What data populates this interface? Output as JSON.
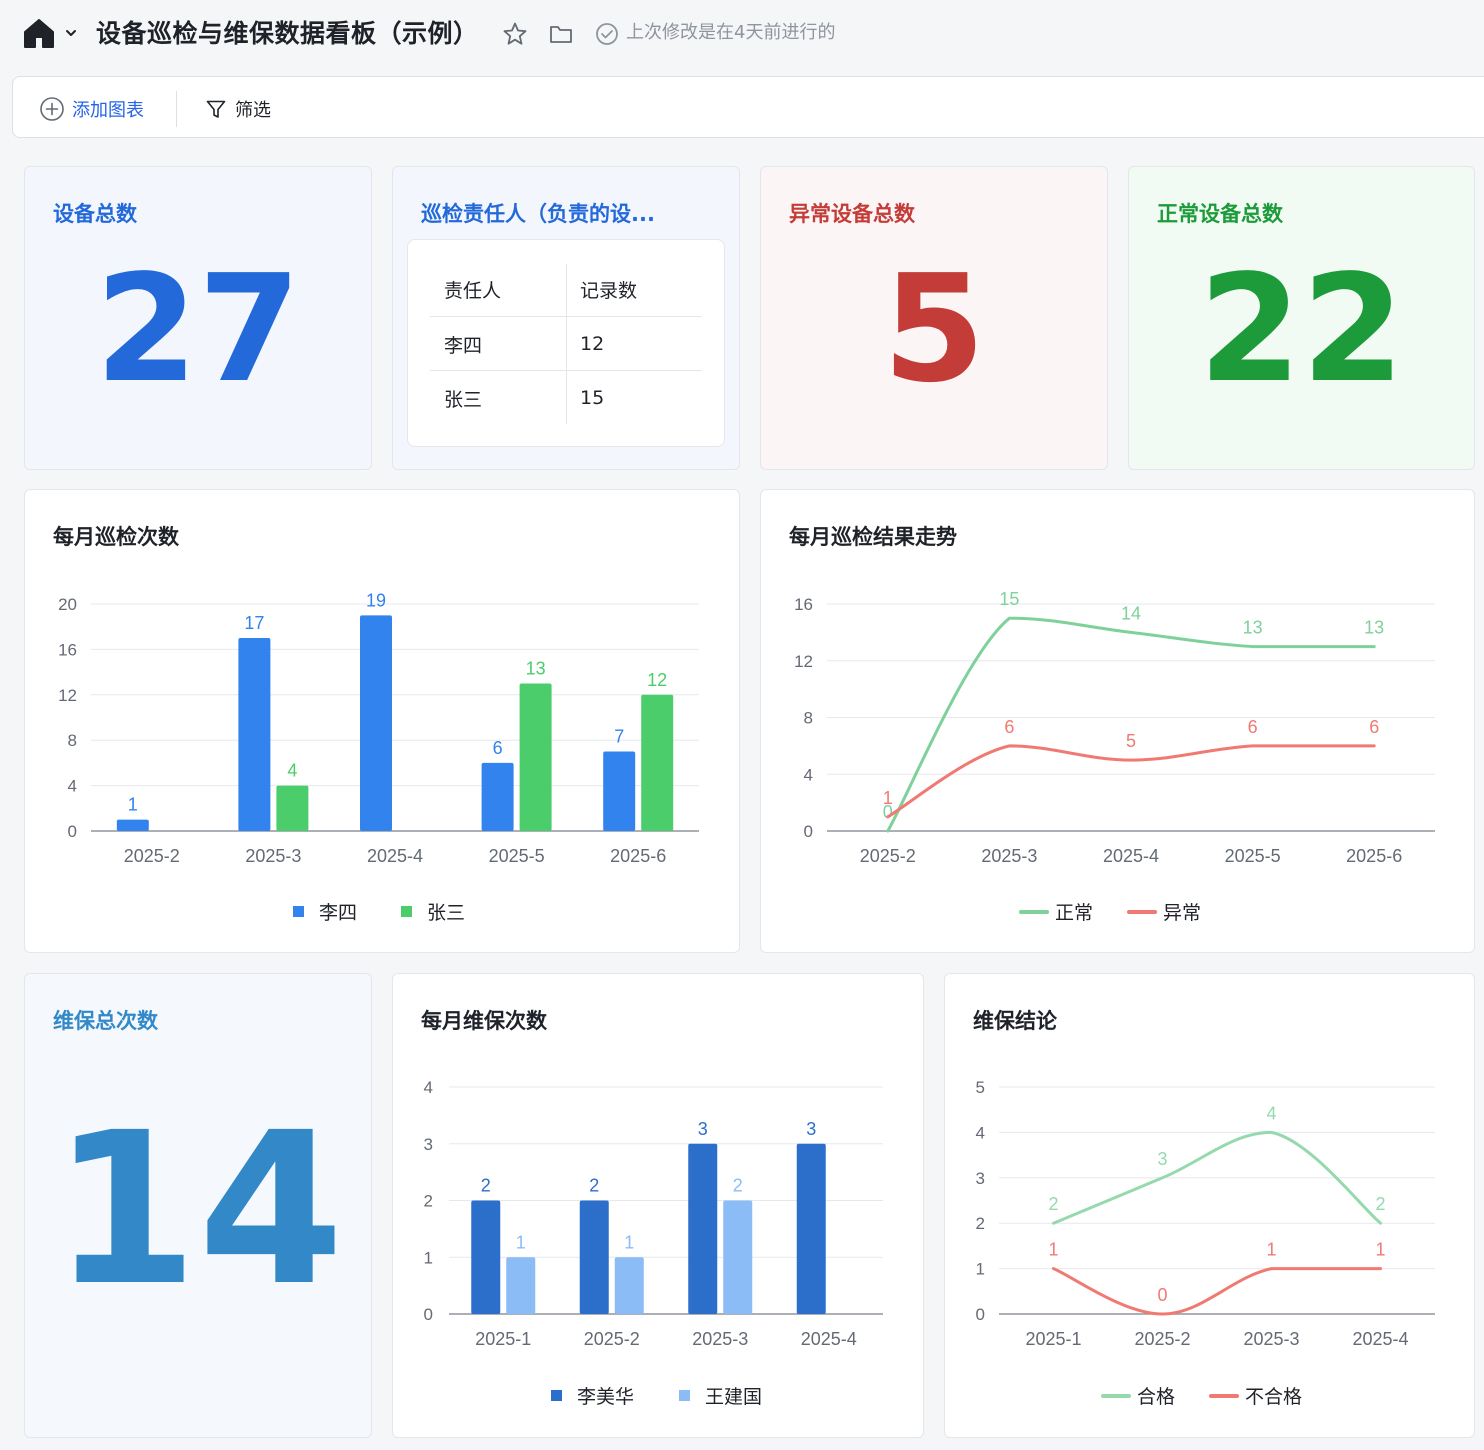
{
  "header": {
    "title": "设备巡检与维保数据看板（示例）",
    "modified": "上次修改是在4天前进行的",
    "colors": {
      "text": "#1f2329",
      "muted": "#8f959e"
    }
  },
  "toolbar": {
    "add_chart": "添加图表",
    "filter": "筛选",
    "accent": "#2463eb"
  },
  "kpis": {
    "total_devices": {
      "title": "设备总数",
      "value": "27",
      "color": "#2369d9",
      "bg": "#f3f7fd"
    },
    "abnormal": {
      "title": "异常设备总数",
      "value": "5",
      "color": "#c43c38",
      "bg": "#fcf5f5"
    },
    "normal": {
      "title": "正常设备总数",
      "value": "22",
      "color": "#1d9a3a",
      "bg": "#f1fbf3"
    },
    "maintenance_total": {
      "title": "维保总次数",
      "value": "14",
      "color": "#3389c8",
      "bg": "#f5f9fd"
    }
  },
  "responsible": {
    "title": "巡检责任人（负责的设...",
    "color": "#2369d9",
    "headers": [
      "责任人",
      "记录数"
    ],
    "rows": [
      [
        "李四",
        "12"
      ],
      [
        "张三",
        "15"
      ]
    ]
  },
  "charts": {
    "monthly_inspections": {
      "title": "每月巡检次数"
    },
    "inspection_trend": {
      "title": "每月巡检结果走势"
    },
    "monthly_maintenance": {
      "title": "每月维保次数"
    },
    "maintenance_result": {
      "title": "维保结论"
    }
  },
  "chart_data": [
    {
      "id": "monthly_inspections",
      "type": "bar",
      "title": "每月巡检次数",
      "categories": [
        "2025-2",
        "2025-3",
        "2025-4",
        "2025-5",
        "2025-6"
      ],
      "ylim": [
        0,
        20
      ],
      "yticks": [
        0,
        4,
        8,
        12,
        16,
        20
      ],
      "series": [
        {
          "name": "李四",
          "color": "#3283ee",
          "values": [
            1,
            17,
            19,
            6,
            7
          ]
        },
        {
          "name": "张三",
          "color": "#4ccd6b",
          "values": [
            null,
            4,
            null,
            13,
            12
          ]
        }
      ],
      "legend": "bottom",
      "grid": true
    },
    {
      "id": "inspection_trend",
      "type": "line",
      "title": "每月巡检结果走势",
      "categories": [
        "2025-2",
        "2025-3",
        "2025-4",
        "2025-5",
        "2025-6"
      ],
      "ylim": [
        0,
        16
      ],
      "yticks": [
        0,
        4,
        8,
        12,
        16
      ],
      "series": [
        {
          "name": "正常",
          "color": "#7ed19a",
          "values": [
            0,
            15,
            14,
            13,
            13
          ]
        },
        {
          "name": "异常",
          "color": "#f07a72",
          "values": [
            1,
            6,
            5,
            6,
            6
          ]
        }
      ],
      "legend": "bottom",
      "grid": true
    },
    {
      "id": "monthly_maintenance",
      "type": "bar",
      "title": "每月维保次数",
      "categories": [
        "2025-1",
        "2025-2",
        "2025-3",
        "2025-4"
      ],
      "ylim": [
        0,
        4
      ],
      "yticks": [
        0,
        1,
        2,
        3,
        4
      ],
      "series": [
        {
          "name": "李美华",
          "color": "#2b6fcb",
          "values": [
            2,
            2,
            3,
            3
          ]
        },
        {
          "name": "王建国",
          "color": "#8bbcf6",
          "values": [
            1,
            1,
            2,
            null
          ]
        }
      ],
      "legend": "bottom",
      "grid": true
    },
    {
      "id": "maintenance_result",
      "type": "line",
      "title": "维保结论",
      "categories": [
        "2025-1",
        "2025-2",
        "2025-3",
        "2025-4"
      ],
      "ylim": [
        0,
        5
      ],
      "yticks": [
        0,
        1,
        2,
        3,
        4,
        5
      ],
      "series": [
        {
          "name": "合格",
          "color": "#95d9ad",
          "values": [
            2,
            3,
            4,
            2
          ]
        },
        {
          "name": "不合格",
          "color": "#f07a72",
          "values": [
            1,
            0,
            1,
            1
          ]
        }
      ],
      "legend": "bottom",
      "grid": true
    }
  ]
}
